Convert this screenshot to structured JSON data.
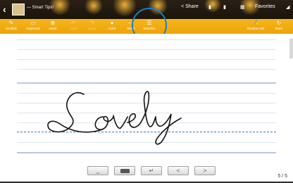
{
  "header": {
    "back_icon": "chevron-left-icon",
    "title": "— Smart Tips!",
    "share_label": "Share",
    "favorites_label": "Favorites"
  },
  "toolbar": {
    "items": [
      {
        "label": "Scribble",
        "icon": "scribble-icon"
      },
      {
        "label": "Keyboard",
        "icon": "keyboard-icon"
      },
      {
        "label": "Insert",
        "icon": "insert-icon"
      },
      {
        "label": "Undo",
        "icon": "undo-icon"
      },
      {
        "label": "Redo",
        "icon": "redo-icon"
      },
      {
        "label": "Color",
        "icon": "color-icon"
      },
      {
        "label": "Width",
        "icon": "width-icon"
      },
      {
        "label": "Baseline",
        "icon": "baseline-icon"
      }
    ],
    "right_items": [
      {
        "label": "Shadow edit",
        "icon": "shadow-edit-icon"
      },
      {
        "label": "More",
        "icon": "more-icon"
      }
    ],
    "highlight_color": "#1a7ec7",
    "accent_color": "#f4ae14"
  },
  "handwriting": {
    "text": "Lovely"
  },
  "keys": [
    {
      "name": "space",
      "glyph": "⎵"
    },
    {
      "name": "backspace",
      "glyph": ""
    },
    {
      "name": "enter",
      "glyph": "↵"
    },
    {
      "name": "left",
      "glyph": "<"
    },
    {
      "name": "right",
      "glyph": ">"
    }
  ],
  "page": {
    "indicator": "5 / 5"
  }
}
